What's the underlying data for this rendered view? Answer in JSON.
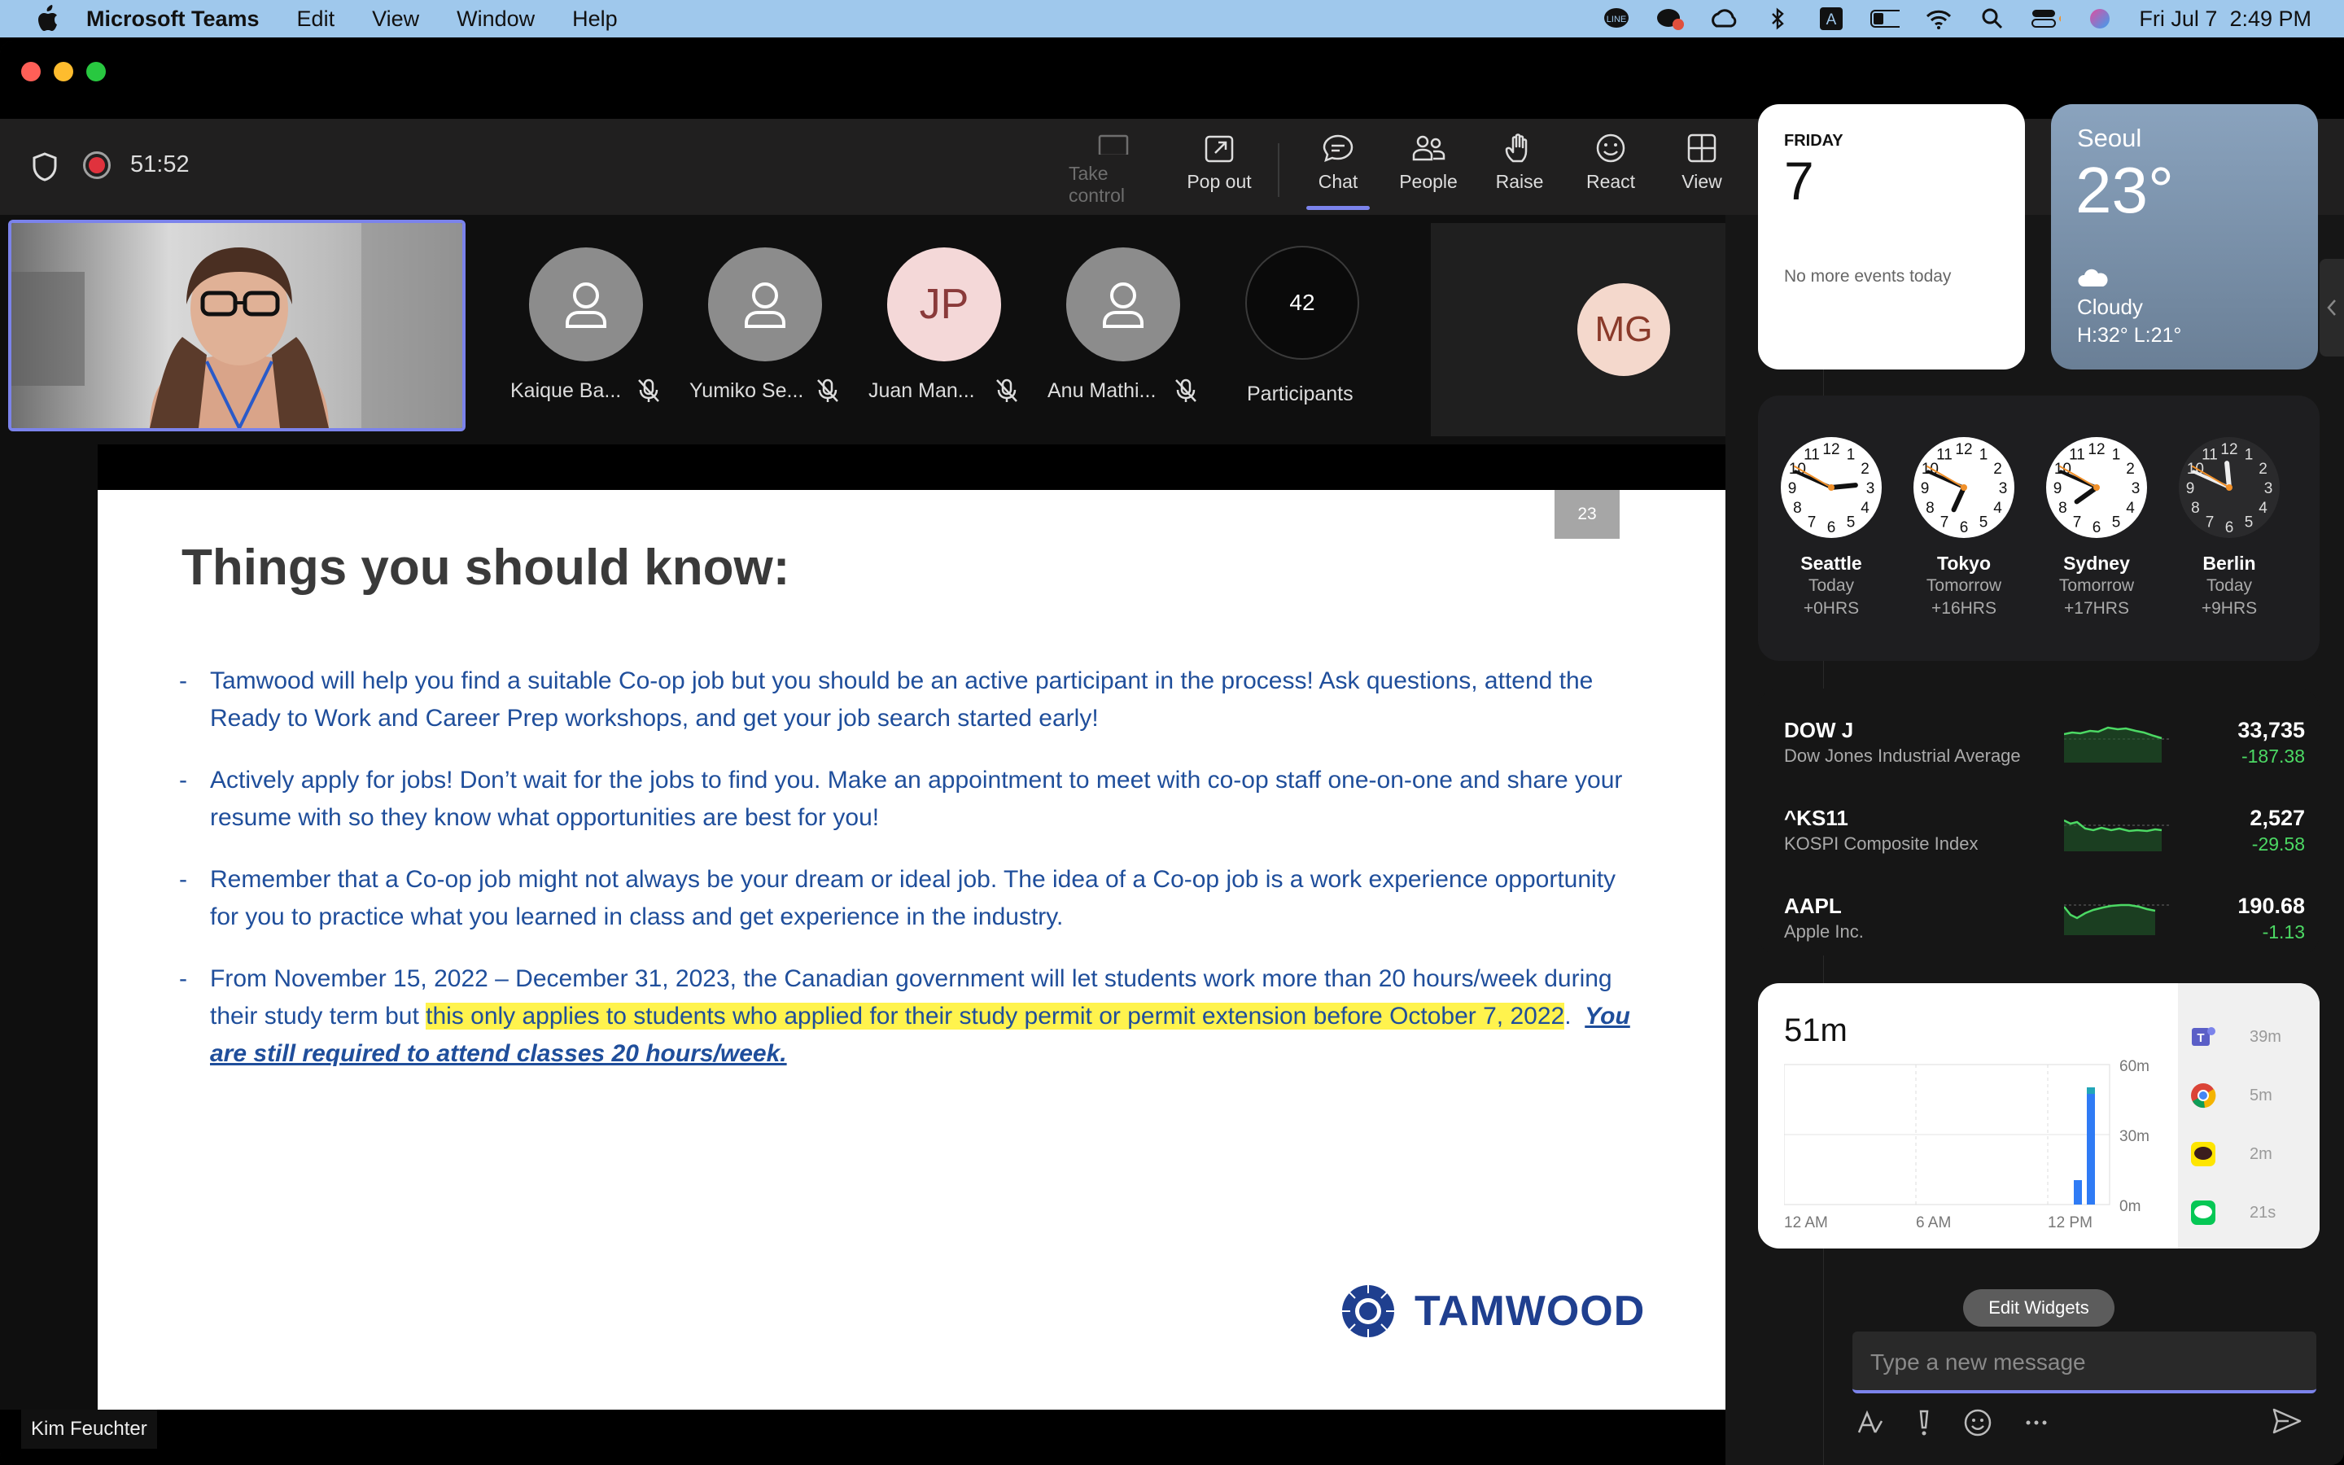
{
  "menubar": {
    "app_name": "Microsoft Teams",
    "items": [
      "Edit",
      "View",
      "Window",
      "Help"
    ],
    "clock": "Fri Jul 7  2:49 PM"
  },
  "meeting": {
    "timer": "51:52",
    "tools": {
      "take_control": "Take control",
      "pop_out": "Pop out",
      "chat": "Chat",
      "people": "People",
      "raise": "Raise",
      "react": "React",
      "view": "View"
    },
    "participants": [
      {
        "name": "Kaique Ba...",
        "initials": ""
      },
      {
        "name": "Yumiko Se...",
        "initials": ""
      },
      {
        "name": "Juan Man...",
        "initials": "JP"
      },
      {
        "name": "Anu Mathi...",
        "initials": ""
      }
    ],
    "participants_count": "42",
    "participants_label": "Participants",
    "tile_initials": "MG",
    "speaker_name": "Kim Feuchter"
  },
  "slide": {
    "number": "23",
    "title": "Things you should know:",
    "bullets": [
      {
        "dash": "-",
        "text": "Tamwood will help you find a suitable Co-op job but you should be an active participant in the process!  Ask questions, attend the Ready to Work and Career Prep workshops, and get your job search started early!"
      },
      {
        "dash": "-",
        "text": "Actively apply for jobs!  Don’t wait for the jobs to find you.  Make an appointment to meet with co-op staff one-on-one and share your resume with so they know what opportunities are best for you!"
      },
      {
        "dash": "-",
        "text": "Remember that a Co-op job might not always be your dream or ideal job.  The idea of a Co-op job is a work experience opportunity for you to practice what you learned in class and get experience in the industry."
      }
    ],
    "bullet4": {
      "dash": "-",
      "part1": "From November 15, 2022 – December 31, 2023, the Canadian government will let students work more than 20 hours/week during their study term but ",
      "highlight": "this only applies to students who applied for their study permit or permit extension before October 7, 2022",
      "part2": ".  ",
      "emphasis": "You are still required to attend classes 20 hours/week."
    },
    "logo_text": "TAMWOOD"
  },
  "widgets": {
    "calendar": {
      "day": "FRIDAY",
      "date": "7",
      "note": "No more events today"
    },
    "weather": {
      "city": "Seoul",
      "temp": "23°",
      "condition": "Cloudy",
      "hilo": "H:32° L:21°"
    },
    "clocks": [
      {
        "city": "Seattle",
        "day": "Today",
        "offset": "+0HRS",
        "hour": 14,
        "minute": 49,
        "night": false
      },
      {
        "city": "Tokyo",
        "day": "Tomorrow",
        "offset": "+16HRS",
        "hour": 6,
        "minute": 49,
        "night": false
      },
      {
        "city": "Sydney",
        "day": "Tomorrow",
        "offset": "+17HRS",
        "hour": 7,
        "minute": 49,
        "night": false
      },
      {
        "city": "Berlin",
        "day": "Today",
        "offset": "+9HRS",
        "hour": 23,
        "minute": 49,
        "night": true
      }
    ],
    "stocks": [
      {
        "symbol": "DOW J",
        "name": "Dow Jones Industrial Average",
        "price": "33,735",
        "change": "-187.38"
      },
      {
        "symbol": "^KS11",
        "name": "KOSPI Composite Index",
        "price": "2,527",
        "change": "-29.58"
      },
      {
        "symbol": "AAPL",
        "name": "Apple Inc.",
        "price": "190.68",
        "change": "-1.13"
      }
    ],
    "screen_time": {
      "total": "51m",
      "y_labels": [
        "60m",
        "30m",
        "0m"
      ],
      "x_labels": [
        "12 AM",
        "6 AM",
        "12 PM"
      ],
      "apps": [
        {
          "icon": "teams-icon",
          "time": "39m"
        },
        {
          "icon": "chrome-icon",
          "time": "5m"
        },
        {
          "icon": "kakaotalk-icon",
          "time": "2m"
        },
        {
          "icon": "line-icon",
          "time": "21s"
        }
      ]
    },
    "edit_label": "Edit Widgets"
  },
  "chat": {
    "placeholder": "Type a new message"
  },
  "colors": {
    "accent": "#7b83eb",
    "record": "#e0323d",
    "slide_text": "#1f4e9b",
    "highlight": "#fff34d"
  }
}
